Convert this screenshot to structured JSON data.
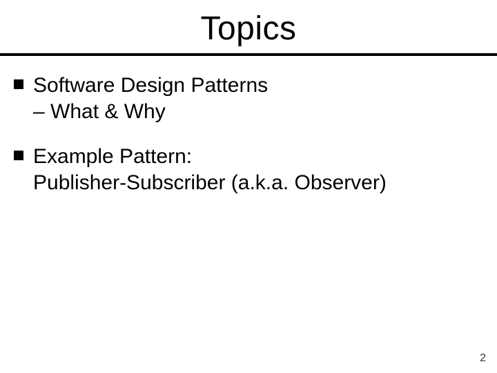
{
  "title": "Topics",
  "bullets": [
    {
      "line1": "Software Design Patterns",
      "line2": "– What & Why"
    },
    {
      "line1": "Example Pattern:",
      "line2": "Publisher-Subscriber (a.k.a. Observer)"
    }
  ],
  "page_number": "2"
}
